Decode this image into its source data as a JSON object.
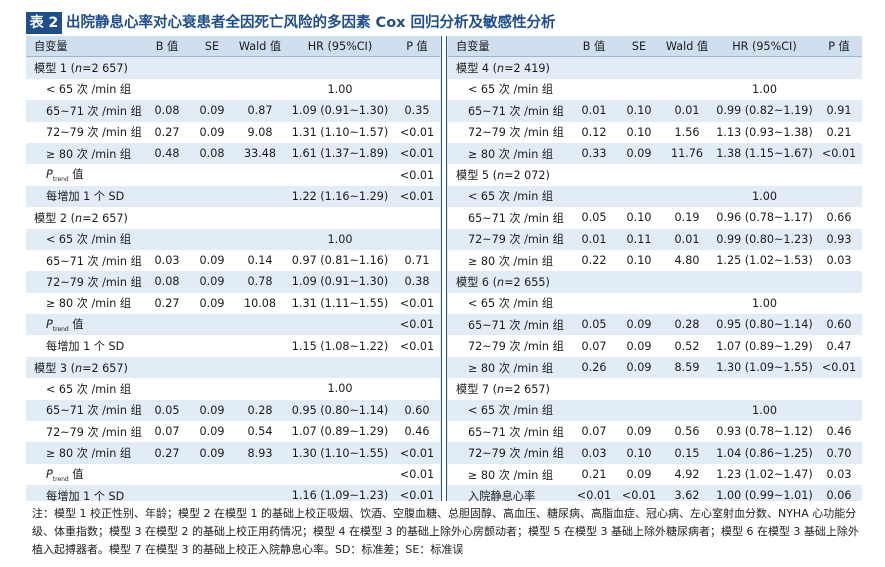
{
  "table_tag": "表 2",
  "title": "出院静息心率对心衰患者全因死亡风险的多因素 Cox 回归分析及敏感性分析",
  "headers": [
    "自变量",
    "B 值",
    "SE",
    "Wald 值",
    "HR (95%CI)",
    "P 值"
  ],
  "left_rows": [
    {
      "type": "model",
      "label": "模型 1",
      "n": "2 657"
    },
    {
      "type": "ref",
      "label": "< 65 次 /min 组",
      "hr": "1.00"
    },
    {
      "type": "data",
      "label": "65~71 次 /min 组",
      "b": "0.08",
      "se": "0.09",
      "wald": "0.87",
      "hr": "1.09 (0.91~1.30)",
      "p": "0.35"
    },
    {
      "type": "data",
      "label": "72~79 次 /min 组",
      "b": "0.27",
      "se": "0.09",
      "wald": "9.08",
      "hr": "1.31 (1.10~1.57)",
      "p": "<0.01"
    },
    {
      "type": "data",
      "label": "≥ 80 次 /min 组",
      "b": "0.48",
      "se": "0.08",
      "wald": "33.48",
      "hr": "1.61 (1.37~1.89)",
      "p": "<0.01"
    },
    {
      "type": "ptrend",
      "label_p": "P",
      "label_sub": "trend",
      "label_suffix": " 值",
      "p": "<0.01"
    },
    {
      "type": "data",
      "label": "每增加 1 个 SD",
      "b": "",
      "se": "",
      "wald": "",
      "hr": "1.22 (1.16~1.29)",
      "p": "<0.01"
    },
    {
      "type": "model",
      "label": "模型 2",
      "n": "2 657"
    },
    {
      "type": "ref",
      "label": "< 65 次 /min 组",
      "hr": "1.00"
    },
    {
      "type": "data",
      "label": "65~71 次 /min 组",
      "b": "0.03",
      "se": "0.09",
      "wald": "0.14",
      "hr": "0.97 (0.81~1.16)",
      "p": "0.71"
    },
    {
      "type": "data",
      "label": "72~79 次 /min 组",
      "b": "0.08",
      "se": "0.09",
      "wald": "0.78",
      "hr": "1.09 (0.91~1.30)",
      "p": "0.38"
    },
    {
      "type": "data",
      "label": "≥ 80 次 /min 组",
      "b": "0.27",
      "se": "0.09",
      "wald": "10.08",
      "hr": "1.31 (1.11~1.55)",
      "p": "<0.01"
    },
    {
      "type": "ptrend",
      "label_p": "P",
      "label_sub": "trend",
      "label_suffix": " 值",
      "p": "<0.01"
    },
    {
      "type": "data",
      "label": "每增加 1 个 SD",
      "b": "",
      "se": "",
      "wald": "",
      "hr": "1.15 (1.08~1.22)",
      "p": "<0.01"
    },
    {
      "type": "model",
      "label": "模型 3",
      "n": "2 657"
    },
    {
      "type": "ref",
      "label": "< 65 次 /min 组",
      "hr": "1.00"
    },
    {
      "type": "data",
      "label": "65~71 次 /min 组",
      "b": "0.05",
      "se": "0.09",
      "wald": "0.28",
      "hr": "0.95 (0.80~1.14)",
      "p": "0.60"
    },
    {
      "type": "data",
      "label": "72~79 次 /min 组",
      "b": "0.07",
      "se": "0.09",
      "wald": "0.54",
      "hr": "1.07 (0.89~1.29)",
      "p": "0.46"
    },
    {
      "type": "data",
      "label": "≥ 80 次 /min 组",
      "b": "0.27",
      "se": "0.09",
      "wald": "8.93",
      "hr": "1.30 (1.10~1.55)",
      "p": "<0.01"
    },
    {
      "type": "ptrend",
      "label_p": "P",
      "label_sub": "trend",
      "label_suffix": " 值",
      "p": "<0.01"
    },
    {
      "type": "data",
      "label": "每增加 1 个 SD",
      "b": "",
      "se": "",
      "wald": "",
      "hr": "1.16 (1.09~1.23)",
      "p": "<0.01"
    }
  ],
  "right_rows": [
    {
      "type": "model",
      "label": "模型 4",
      "n": "2 419"
    },
    {
      "type": "ref",
      "label": "< 65 次 /min 组",
      "hr": "1.00"
    },
    {
      "type": "data",
      "label": "65~71 次 /min 组",
      "b": "0.01",
      "se": "0.10",
      "wald": "0.01",
      "hr": "0.99 (0.82~1.19)",
      "p": "0.91"
    },
    {
      "type": "data",
      "label": "72~79 次 /min 组",
      "b": "0.12",
      "se": "0.10",
      "wald": "1.56",
      "hr": "1.13 (0.93~1.38)",
      "p": "0.21"
    },
    {
      "type": "data",
      "label": "≥ 80 次 /min 组",
      "b": "0.33",
      "se": "0.09",
      "wald": "11.76",
      "hr": "1.38 (1.15~1.67)",
      "p": "<0.01"
    },
    {
      "type": "model",
      "label": "模型 5",
      "n": "2 072"
    },
    {
      "type": "ref",
      "label": "< 65 次 /min 组",
      "hr": "1.00"
    },
    {
      "type": "data",
      "label": "65~71 次 /min 组",
      "b": "0.05",
      "se": "0.10",
      "wald": "0.19",
      "hr": "0.96 (0.78~1.17)",
      "p": "0.66"
    },
    {
      "type": "data",
      "label": "72~79 次 /min 组",
      "b": "0.01",
      "se": "0.11",
      "wald": "0.01",
      "hr": "0.99 (0.80~1.23)",
      "p": "0.93"
    },
    {
      "type": "data",
      "label": "≥ 80 次 /min 组",
      "b": "0.22",
      "se": "0.10",
      "wald": "4.80",
      "hr": "1.25 (1.02~1.53)",
      "p": "0.03"
    },
    {
      "type": "model",
      "label": "模型 6",
      "n": "2 655"
    },
    {
      "type": "ref",
      "label": "< 65 次 /min 组",
      "hr": "1.00"
    },
    {
      "type": "data",
      "label": "65~71 次 /min 组",
      "b": "0.05",
      "se": "0.09",
      "wald": "0.28",
      "hr": "0.95 (0.80~1.14)",
      "p": "0.60"
    },
    {
      "type": "data",
      "label": "72~79 次 /min 组",
      "b": "0.07",
      "se": "0.09",
      "wald": "0.52",
      "hr": "1.07 (0.89~1.29)",
      "p": "0.47"
    },
    {
      "type": "data",
      "label": "≥ 80 次 /min 组",
      "b": "0.26",
      "se": "0.09",
      "wald": "8.59",
      "hr": "1.30 (1.09~1.55)",
      "p": "<0.01"
    },
    {
      "type": "model",
      "label": "模型 7",
      "n": "2 657"
    },
    {
      "type": "ref",
      "label": "< 65 次 /min 组",
      "hr": "1.00"
    },
    {
      "type": "data",
      "label": "65~71 次 /min 组",
      "b": "0.07",
      "se": "0.09",
      "wald": "0.56",
      "hr": "0.93 (0.78~1.12)",
      "p": "0.46"
    },
    {
      "type": "data",
      "label": "72~79 次 /min 组",
      "b": "0.03",
      "se": "0.10",
      "wald": "0.15",
      "hr": "1.04 (0.86~1.25)",
      "p": "0.70"
    },
    {
      "type": "data",
      "label": "≥ 80 次 /min 组",
      "b": "0.21",
      "se": "0.09",
      "wald": "4.92",
      "hr": "1.23 (1.02~1.47)",
      "p": "0.03"
    },
    {
      "type": "data",
      "label": "入院静息心率",
      "b": "<0.01",
      "se": "<0.01",
      "wald": "3.62",
      "hr": "1.00 (0.99~1.01)",
      "p": "0.06"
    }
  ],
  "note": "注：模型 1 校正性别、年龄；模型 2 在模型 1 的基础上校正吸烟、饮酒、空腹血糖、总胆固醇、高血压、糖尿病、高脂血症、冠心病、左心室射血分数、NYHA 心功能分级、体重指数；模型 3 在模型 2 的基础上校正用药情况；模型 4 在模型 3 的基础上除外心房颤动者；模型 5 在模型 3 基础上除外糖尿病者；模型 6 在模型 3 基础上除外植入起搏器者。模型 7 在模型 3 的基础上校正入院静息心率。SD：标准差；SE：标准误",
  "colors": {
    "brand": "#1f4e8c",
    "table_bg": "#e2ecf7",
    "header_bg": "#cfdff0",
    "alt_row": "#ffffff"
  }
}
